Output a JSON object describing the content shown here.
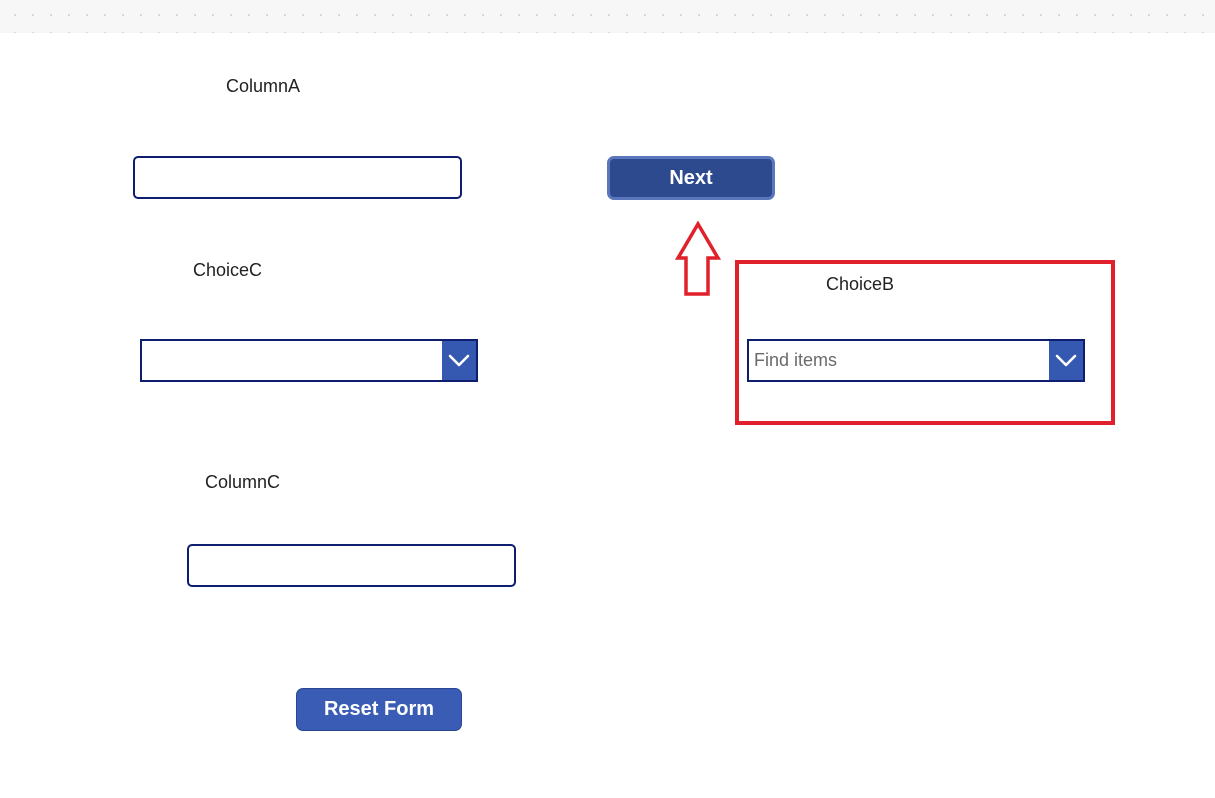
{
  "form": {
    "column_a": {
      "label": "ColumnA",
      "value": ""
    },
    "choice_c": {
      "label": "ChoiceC",
      "value": ""
    },
    "column_c": {
      "label": "ColumnC",
      "value": ""
    },
    "choice_b": {
      "label": "ChoiceB",
      "placeholder": "Find items"
    }
  },
  "buttons": {
    "next_label": "Next",
    "reset_label": "Reset Form"
  },
  "annotations": {
    "highlight_color": "#e0202a",
    "arrow_direction": "up"
  },
  "colors": {
    "field_border": "#0f1d6e",
    "chevron_bg": "#3558b0",
    "next_bg": "#2e4a8f",
    "reset_bg": "#3a5cb5"
  },
  "icons": {
    "dropdown": "chevron-down-icon",
    "annotation": "arrow-up-icon"
  }
}
